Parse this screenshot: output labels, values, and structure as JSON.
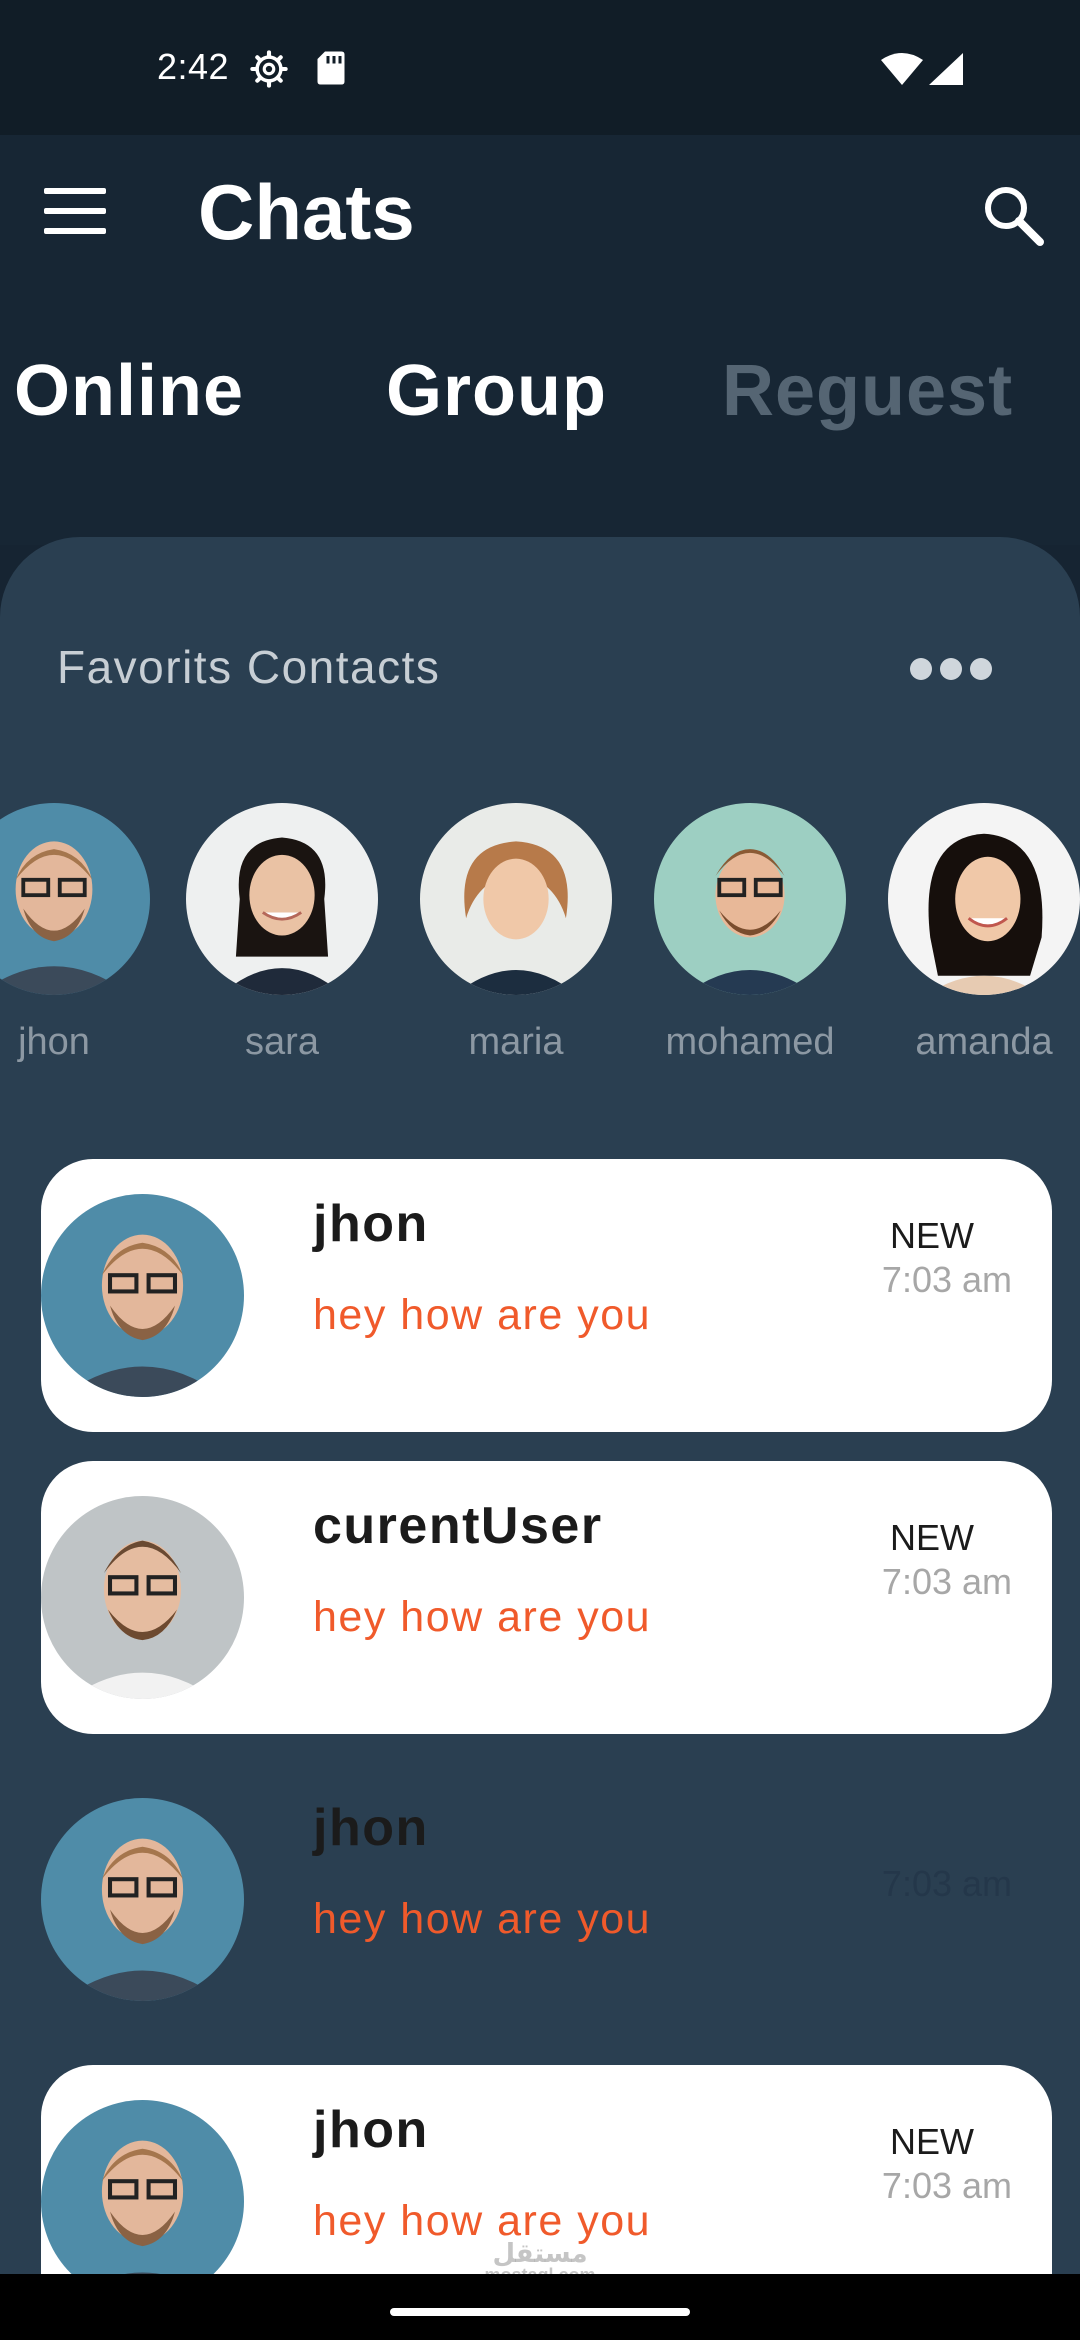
{
  "status_bar": {
    "time": "2:42",
    "icons": [
      "gear-icon",
      "sd-card-icon",
      "wifi-icon",
      "cell-signal-icon"
    ]
  },
  "app_bar": {
    "title": "Chats",
    "menu_icon": "hamburger-menu-icon",
    "search_icon": "search-icon"
  },
  "tabs": [
    {
      "label": "Online",
      "color": "#ffffff"
    },
    {
      "label": "Group",
      "color": "#ffffff"
    },
    {
      "label": "Reguest",
      "color": "#556573"
    }
  ],
  "favorites": {
    "title": "Favorits Contacts",
    "more_icon": "more-dots-icon",
    "contacts": [
      {
        "name": "jhon"
      },
      {
        "name": "sara"
      },
      {
        "name": "maria"
      },
      {
        "name": "mohamed"
      },
      {
        "name": "amanda"
      }
    ]
  },
  "chats": [
    {
      "name": "jhon",
      "message": "hey how are you",
      "badge": "NEW",
      "time": "7:03 am"
    },
    {
      "name": "curentUser",
      "message": "hey how are you",
      "badge": "NEW",
      "time": "7:03 am"
    },
    {
      "name": "jhon",
      "message": "hey how are you",
      "badge": "",
      "time": "7:03 am"
    },
    {
      "name": "jhon",
      "message": "hey how are you",
      "badge": "NEW",
      "time": "7:03 am"
    }
  ],
  "watermark": {
    "arabic": "مستقل",
    "latin": "mostaql.com"
  },
  "colors": {
    "status_bar_bg": "#111d27",
    "app_bar_bg": "#172634",
    "panel_bg": "#2a3f51",
    "message_accent": "#f05a2b"
  }
}
